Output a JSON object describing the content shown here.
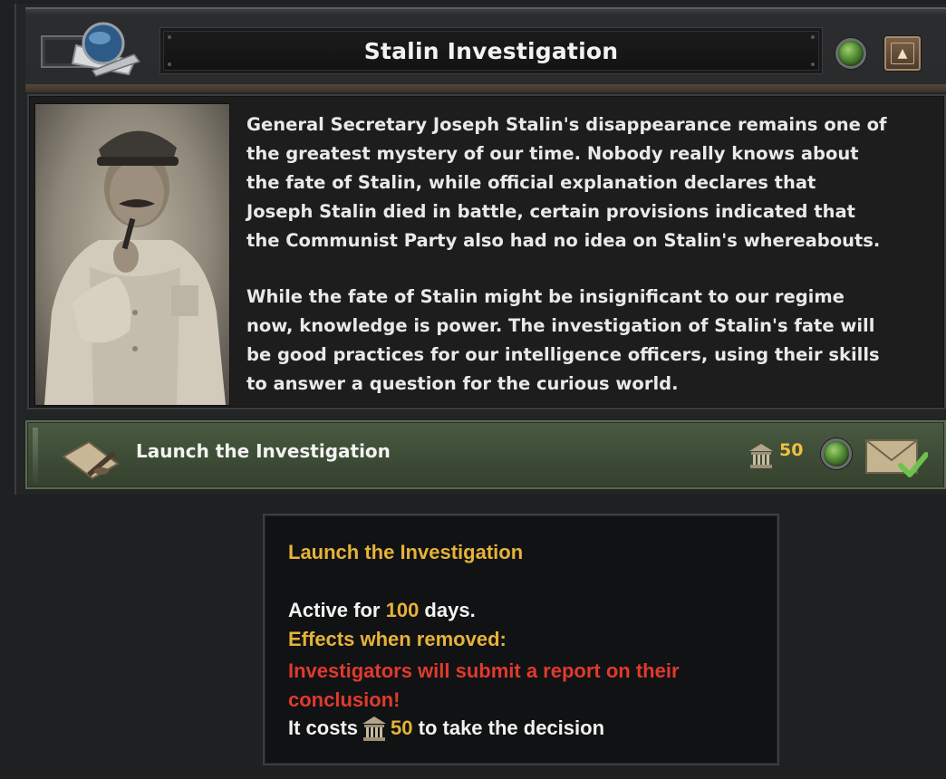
{
  "header": {
    "title": "Stalin Investigation"
  },
  "description": {
    "paragraph_1": "General Secretary Joseph Stalin's disappearance remains one of\nthe greatest mystery of our time. Nobody really knows about\nthe fate of Stalin, while official explanation declares that\nJoseph Stalin died in battle, certain provisions indicated that\nthe Communist Party also had no idea on Stalin's whereabouts.",
    "paragraph_2": "While the fate of Stalin might be insignificant to our regime\nnow, knowledge is power. The investigation of Stalin's fate will\nbe good practices for our intelligence officers, using their skills\nto answer a question for the curious world."
  },
  "decision": {
    "label": "Launch the Investigation",
    "cost": "50"
  },
  "tooltip": {
    "title": "Launch the Investigation",
    "active_prefix": "Active for ",
    "active_days": "100",
    "active_suffix": " days.",
    "effects_label": "Effects when removed:",
    "effect_text": "Investigators will submit a report on their conclusion!",
    "cost_prefix": "It costs",
    "cost_value": "50",
    "cost_suffix": " to take the decision"
  },
  "colors": {
    "highlight_yellow": "#e6b23a",
    "effect_red": "#e03a2e",
    "decision_green": "#3e4d37"
  },
  "icons": {
    "emblem": "globe-quill-emblem-icon",
    "status": "green-orb-icon",
    "collapse": "chevron-up-icon",
    "decision": "quill-paper-icon",
    "political_power": "political-power-icon",
    "confirm": "envelope-check-icon"
  }
}
